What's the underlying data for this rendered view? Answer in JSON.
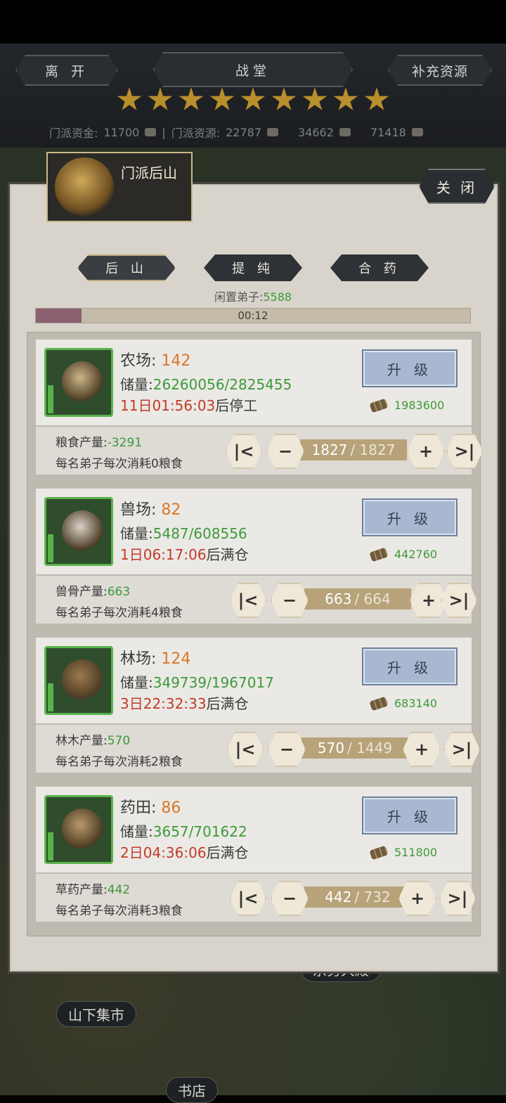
{
  "hud": {
    "leave_label": "离 开",
    "hall_label": "战堂",
    "supply_label": "补充资源",
    "stars": 9,
    "funds_label": "门派资金:",
    "funds_value": "11700",
    "resources_label": "门派资源:",
    "res1": "22787",
    "res2": "34662",
    "res3": "71418"
  },
  "map": {
    "market_label": "山下集市",
    "bookstore_label": "书店",
    "hidden_label": "宗务大殿"
  },
  "panel": {
    "title": "门派后山",
    "close_label": "关 闭",
    "tabs": [
      "后 山",
      "提 纯",
      "合 药"
    ],
    "idle_label": "闲置弟子:",
    "idle_value": "5588",
    "progress_time": "00:12",
    "progress_fraction": 0.105
  },
  "cards": [
    {
      "name": "农场",
      "level": "142",
      "storage_label": "储量:",
      "storage": "26260056/2825455",
      "time": "11日01:56:03",
      "time_suffix": "后停工",
      "upgrade_label": "升 级",
      "cost": "1983600",
      "prod_label": "粮食产量:",
      "prod_value": "-3291",
      "consume": "每名弟子每次消耗0粮食",
      "count": "1827",
      "max": "1827",
      "art_color": "#cdb58a"
    },
    {
      "name": "兽场",
      "level": "82",
      "storage_label": "储量:",
      "storage": "5487/608556",
      "time": "1日06:17:06",
      "time_suffix": "后满仓",
      "upgrade_label": "升 级",
      "cost": "442760",
      "prod_label": "兽骨产量:",
      "prod_value": "663",
      "consume": "每名弟子每次消耗4粮食",
      "count": "663",
      "max": "664",
      "art_color": "#d8d2c6"
    },
    {
      "name": "林场",
      "level": "124",
      "storage_label": "储量:",
      "storage": "349739/1967017",
      "time": "3日22:32:33",
      "time_suffix": "后满仓",
      "upgrade_label": "升 级",
      "cost": "683140",
      "prod_label": "林木产量:",
      "prod_value": "570",
      "consume": "每名弟子每次消耗2粮食",
      "count": "570",
      "max": "1449",
      "art_color": "#9a7a4e"
    },
    {
      "name": "药田",
      "level": "86",
      "storage_label": "储量:",
      "storage": "3657/701622",
      "time": "2日04:36:06",
      "time_suffix": "后满仓",
      "upgrade_label": "升 级",
      "cost": "511800",
      "prod_label": "草药产量:",
      "prod_value": "442",
      "consume": "每名弟子每次消耗3粮食",
      "count": "442",
      "max": "732",
      "art_color": "#b89a6a"
    }
  ],
  "colors": {
    "accent_green": "#3c9a3a",
    "level_orange": "#d9772a",
    "time_red": "#c23b2a"
  }
}
